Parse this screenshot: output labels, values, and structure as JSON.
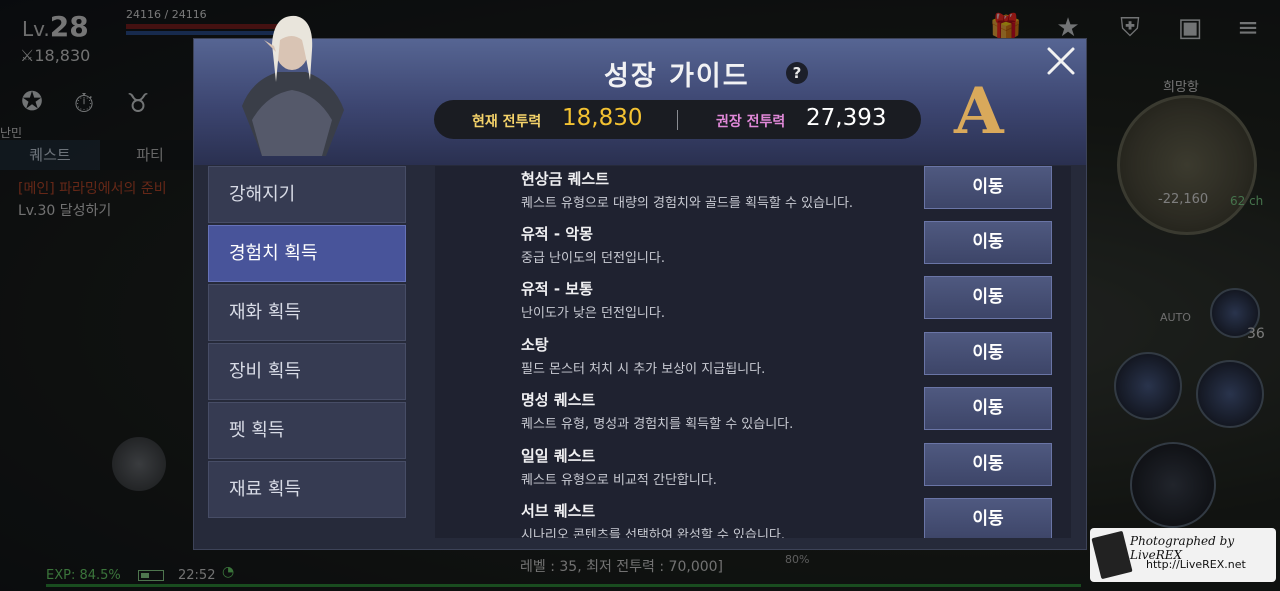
{
  "hud": {
    "level_prefix": "Lv.",
    "level": "28",
    "combat_power": "⚔18,830",
    "hp": "24116 / 24116",
    "tab_quest": "퀘스트",
    "tab_party": "파티",
    "partial_text": "난민",
    "quest_title": "[메인] 파라밍에서의 준비",
    "quest_sub": "Lv.30 달성하기",
    "minimap_name": "희망항",
    "minimap_coord": "-22,160",
    "minimap_channel": "62 ch",
    "auto_label": "AUTO",
    "potion_count": "36",
    "exp": "EXP: 84.5%",
    "time": "22:52",
    "bottom_text": "레벨 : 35, 최저 전투력 : 70,000]",
    "bottom_pct": "80%",
    "watermark_top": "Photographed by LiveREX",
    "watermark_bottom": "http://LiveREX.net"
  },
  "dialog": {
    "title": "성장 가이드",
    "help": "?",
    "current_power_label": "현재 전투력",
    "current_power": "18,830",
    "recommended_power_label": "권장 전투력",
    "recommended_power": "27,393",
    "grade": "A"
  },
  "sidebar": {
    "items": [
      {
        "label": "강해지기"
      },
      {
        "label": "경험치 획득"
      },
      {
        "label": "재화 획득"
      },
      {
        "label": "장비 획득"
      },
      {
        "label": "펫 획득"
      },
      {
        "label": "재료 획득"
      }
    ],
    "active_index": 1
  },
  "list": {
    "button_label": "이동",
    "rows": [
      {
        "title": "현상금 퀘스트",
        "desc": "퀘스트 유형으로 대량의 경험치와 골드를 획득할 수 있습니다."
      },
      {
        "title": "유적 - 악몽",
        "desc": "중급 난이도의 던전입니다."
      },
      {
        "title": "유적 - 보통",
        "desc": "난이도가 낮은 던전입니다."
      },
      {
        "title": "소탕",
        "desc": "필드 몬스터 처치 시 추가 보상이 지급됩니다."
      },
      {
        "title": "명성 퀘스트",
        "desc": "퀘스트 유형, 명성과 경험치를 획득할 수 있습니다."
      },
      {
        "title": "일일 퀘스트",
        "desc": "퀘스트 유형으로 비교적 간단합니다."
      },
      {
        "title": "서브 퀘스트",
        "desc": "시나리오 콘텐츠를 선택하여 완성할 수 있습니다."
      }
    ]
  },
  "icons": {
    "hud_top_left": [
      "medal-icon",
      "hot-event-icon",
      "boss-icon"
    ],
    "hud_top_right": [
      "gift-icon",
      "star-badge-icon",
      "guild-crest-icon",
      "treasure-chest-icon",
      "menu-icon"
    ]
  },
  "colors": {
    "current_power": "#f3c232",
    "recommended_label": "#e088d8",
    "active_tab": "#48549a",
    "grade": "#d9a95b"
  }
}
